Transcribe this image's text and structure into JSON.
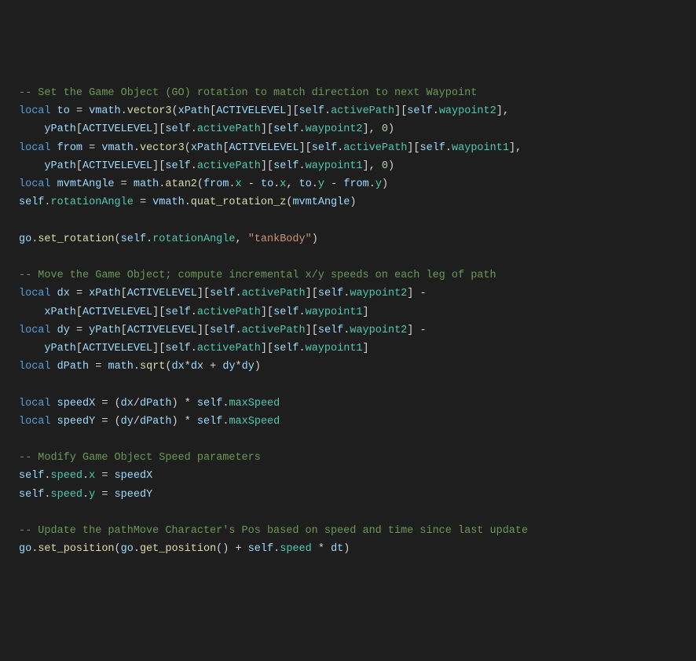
{
  "c1": "-- Set the Game Object (GO) rotation to match direction to next Waypoint",
  "l2": {
    "kw": "local",
    "v1": "to",
    "fn": "vector3",
    "obj": "vmath",
    "idx": "xPath",
    "lvl": "ACTIVELEVEL",
    "self": "self",
    "ap": "activePath",
    "wp": "waypoint2"
  },
  "l3": {
    "idx": "yPath",
    "lvl": "ACTIVELEVEL",
    "self": "self",
    "ap": "activePath",
    "wp": "waypoint2",
    "num": "0"
  },
  "l4": {
    "kw": "local",
    "v1": "from",
    "fn": "vector3",
    "obj": "vmath",
    "idx": "xPath",
    "lvl": "ACTIVELEVEL",
    "self": "self",
    "ap": "activePath",
    "wp": "waypoint1"
  },
  "l5": {
    "idx": "yPath",
    "lvl": "ACTIVELEVEL",
    "self": "self",
    "ap": "activePath",
    "wp": "waypoint1",
    "num": "0"
  },
  "l6": {
    "kw": "local",
    "v1": "mvmtAngle",
    "obj": "math",
    "fn": "atan2",
    "a": "from",
    "ax": "x",
    "b": "to",
    "bx": "x",
    "c": "to",
    "cy": "y",
    "d": "from",
    "dy": "y"
  },
  "l7": {
    "self": "self",
    "ra": "rotationAngle",
    "obj": "vmath",
    "fn": "quat_rotation_z",
    "arg": "mvmtAngle"
  },
  "l8": {
    "obj": "go",
    "fn": "set_rotation",
    "self": "self",
    "ra": "rotationAngle",
    "str": "\"tankBody\""
  },
  "c2": "-- Move the Game Object; compute incremental x/y speeds on each leg of path",
  "l10": {
    "kw": "local",
    "v1": "dx",
    "idx": "xPath",
    "lvl": "ACTIVELEVEL",
    "self": "self",
    "ap": "activePath",
    "wp": "waypoint2"
  },
  "l11": {
    "idx": "xPath",
    "lvl": "ACTIVELEVEL",
    "self": "self",
    "ap": "activePath",
    "wp": "waypoint1"
  },
  "l12": {
    "kw": "local",
    "v1": "dy",
    "idx": "yPath",
    "lvl": "ACTIVELEVEL",
    "self": "self",
    "ap": "activePath",
    "wp": "waypoint2"
  },
  "l13": {
    "idx": "yPath",
    "lvl": "ACTIVELEVEL",
    "self": "self",
    "ap": "activePath",
    "wp": "waypoint1"
  },
  "l14": {
    "kw": "local",
    "v1": "dPath",
    "obj": "math",
    "fn": "sqrt",
    "dx": "dx",
    "dy": "dy"
  },
  "l15": {
    "kw": "local",
    "v1": "speedX",
    "dx": "dx",
    "dp": "dPath",
    "self": "self",
    "ms": "maxSpeed"
  },
  "l16": {
    "kw": "local",
    "v1": "speedY",
    "dy": "dy",
    "dp": "dPath",
    "self": "self",
    "ms": "maxSpeed"
  },
  "c3": "-- Modify Game Object Speed parameters",
  "l18": {
    "self": "self",
    "sp": "speed",
    "ax": "x",
    "v": "speedX"
  },
  "l19": {
    "self": "self",
    "sp": "speed",
    "ax": "y",
    "v": "speedY"
  },
  "c4": "-- Update the pathMove Character's Pos based on speed and time since last update",
  "l21": {
    "obj": "go",
    "fn1": "set_position",
    "fn2": "get_position",
    "self": "self",
    "sp": "speed",
    "dt": "dt"
  }
}
